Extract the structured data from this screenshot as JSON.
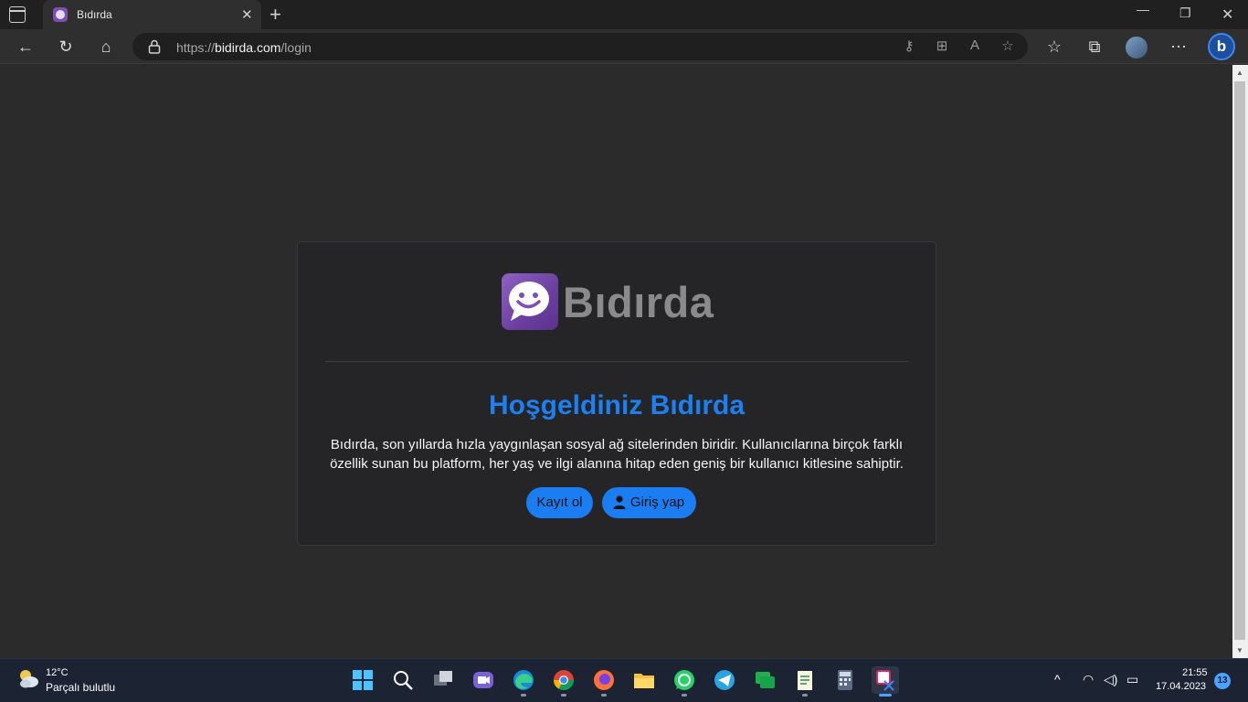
{
  "browser": {
    "tab_title": "Bıdırda",
    "url_scheme": "https://",
    "url_host": "bidirda.com",
    "url_path": "/login",
    "new_tab_symbol": "+",
    "close_symbol": "✕"
  },
  "page": {
    "logo_text": "Bıdırda",
    "heading": "Hoşgeldiniz Bıdırda",
    "description_line1": "Bıdırda, son yıllarda hızla yaygınlaşan sosyal ağ sitelerinden biridir. Kullanıcılarına birçok farklı",
    "description_line2": "özellik sunan bu platform, her yaş ve ilgi alanına hitap eden geniş bir kullanıcı kitlesine sahiptir.",
    "register_button": "Kayıt ol",
    "login_button": "Giriş yap",
    "accent_color": "#1a7df2",
    "brand_color": "#7d4fb0"
  },
  "taskbar": {
    "weather_temp": "12°C",
    "weather_desc": "Parçalı bulutlu",
    "time": "21:55",
    "date": "17.04.2023",
    "notifications": "13",
    "apps": [
      "start-icon",
      "search-icon",
      "task-view-icon",
      "teams-icon",
      "edge-icon",
      "chrome-icon",
      "firefox-icon",
      "file-explorer-icon",
      "whatsapp-icon",
      "telegram-icon",
      "chat-icon",
      "notepad-icon",
      "calculator-icon",
      "snipping-tool-icon"
    ]
  }
}
